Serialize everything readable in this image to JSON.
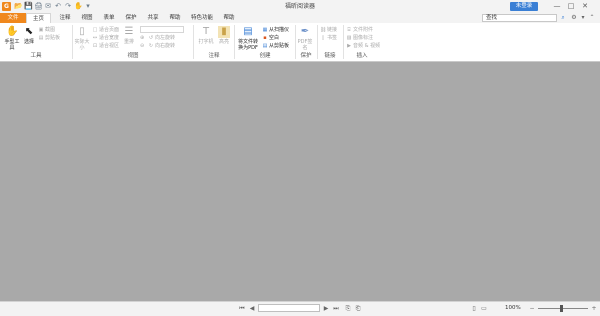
{
  "window": {
    "title": "福昕阅读器",
    "login_label": "未登录",
    "minimize_glyph": "—",
    "maximize_glyph": "□",
    "close_glyph": "✕"
  },
  "quick_access": [
    "📂",
    "💾",
    "🖨",
    "✉",
    "↶",
    "↷",
    "✋",
    "▾"
  ],
  "menu": {
    "tabs": [
      "文件",
      "主页",
      "注释",
      "视图",
      "表单",
      "保护",
      "共享",
      "帮助",
      "特色功能",
      "帮助"
    ],
    "active_tab": "主页"
  },
  "search": {
    "placeholder": "查找",
    "icon": "search-icon"
  },
  "ribbon": {
    "groups": {
      "tools": "工具",
      "view": "视图",
      "comment": "注释",
      "create": "创建",
      "protect": "保护",
      "links": "链接",
      "insert": "插入"
    },
    "tools": {
      "hand": "手型工具",
      "select": "选择",
      "snapshot": "截图",
      "clipboard": "剪贴板"
    },
    "view": {
      "actual_size": "实际大小",
      "fit_page": "适合页面",
      "fit_width": "适合宽度",
      "fit_visible": "适合视区",
      "reflow": "重排",
      "rotate_left": "向左旋转",
      "rotate_right": "向右旋转"
    },
    "comment": {
      "typewriter": "打字机",
      "highlight": "高亮"
    },
    "create": {
      "to_pdf_line1": "将文件转",
      "to_pdf_line2": "换为PDF",
      "from_scanner": "从扫描仪",
      "blank": "空白",
      "from_clipboard": "从剪贴板"
    },
    "protect": {
      "sign": "PDF签名"
    },
    "links": {
      "link": "链接",
      "bookmark": "书签"
    },
    "insert": {
      "file_attachment": "文件附件",
      "image_annotation": "图像标注",
      "audio_video": "音频 & 视频"
    }
  },
  "statusbar": {
    "first": "⏮",
    "prev": "◀",
    "next": "▶",
    "last": "⏭",
    "zoom": "100%",
    "zoom_out": "−",
    "zoom_in": "+"
  }
}
